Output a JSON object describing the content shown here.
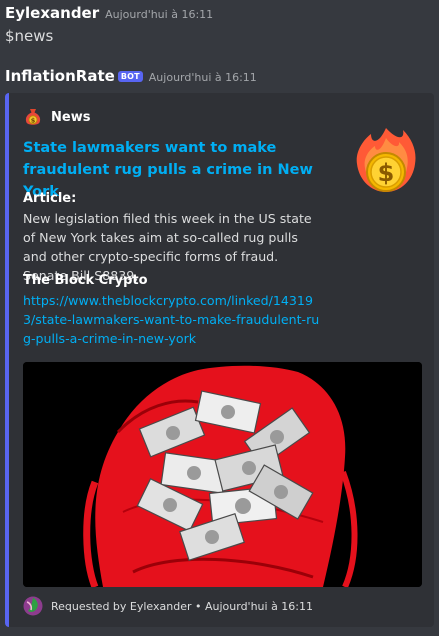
{
  "message1": {
    "author": "Eylexander",
    "timestamp": "Aujourd'hui à 16:11",
    "content": "$news"
  },
  "message2": {
    "author": "InflationRate",
    "badge": "BOT",
    "timestamp": "Aujourd'hui à 16:11"
  },
  "embed": {
    "accent_color": "#5865f2",
    "author_name": "News",
    "author_icon": "money-bag-icon",
    "title": "State lawmakers want to make fraudulent rug pulls a crime in New York",
    "thumbnail_icon": "flaming-dollar-coin-icon",
    "article_label": "Article:",
    "article_text": "New legislation filed this week in the US state of New York takes aim at so-called rug pulls and other crypto-specific forms of fraud. Senate Bill S8839,",
    "source_label": "The Block Crypto",
    "source_url": "https://www.theblockcrypto.com/linked/143193/state-lawmakers-want-to-make-fraudulent-rug-pulls-a-crime-in-new-york",
    "image_icon": "red-bag-of-cash-image",
    "footer_text": "Requested by Eylexander • Aujourd'hui à 16:11",
    "footer_icon": "user-avatar-icon"
  }
}
